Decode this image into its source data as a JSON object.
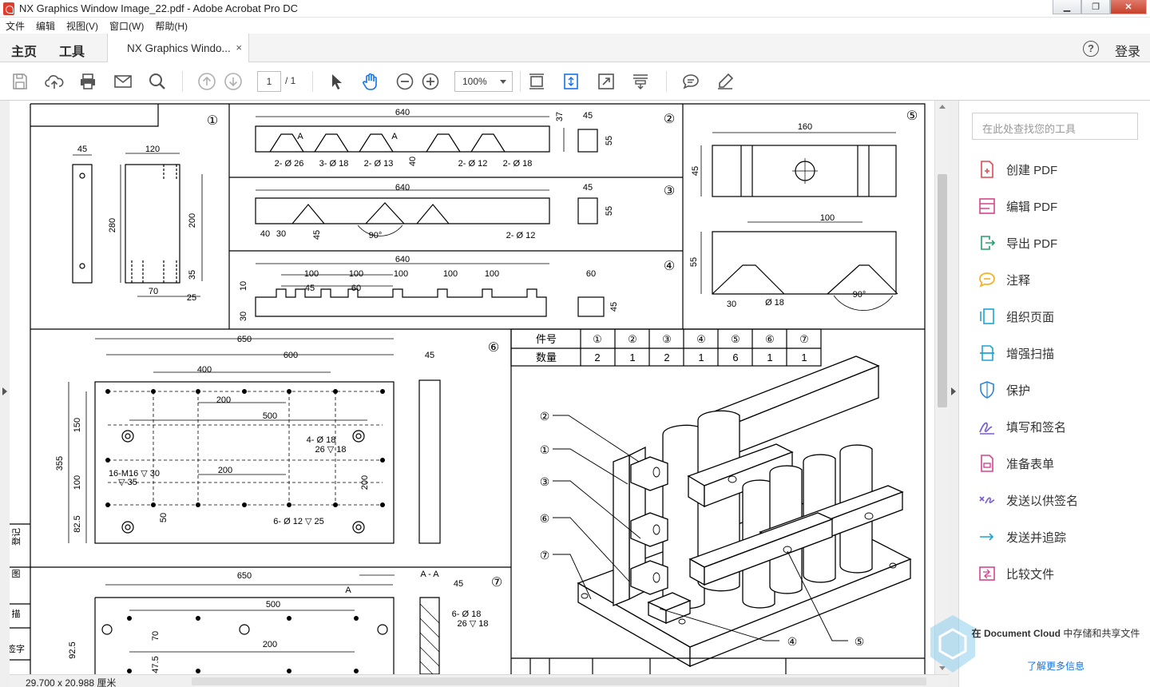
{
  "window": {
    "title": "NX Graphics Window Image_22.pdf - Adobe Acrobat Pro DC",
    "buttons": [
      "minimize",
      "maximize",
      "close"
    ]
  },
  "menu": [
    "文件",
    "编辑",
    "视图(V)",
    "窗口(W)",
    "帮助(H)"
  ],
  "tabs": {
    "home": "主页",
    "tools": "工具",
    "document": "NX Graphics Windo...",
    "close": "×",
    "help": "?",
    "login": "登录"
  },
  "toolbar": {
    "page_current": "1",
    "page_total": "/ 1",
    "zoom": "100%"
  },
  "status": {
    "dimensions": "29.700 x 20.988 厘米"
  },
  "tools_pane": {
    "search_placeholder": "在此处查找您的工具",
    "items": [
      {
        "label": "创建 PDF",
        "icon": "create-pdf-icon",
        "color": "#e34850"
      },
      {
        "label": "编辑 PDF",
        "icon": "edit-pdf-icon",
        "color": "#d7448c"
      },
      {
        "label": "导出 PDF",
        "icon": "export-pdf-icon",
        "color": "#26a06b"
      },
      {
        "label": "注释",
        "icon": "comment-icon",
        "color": "#f2b328"
      },
      {
        "label": "组织页面",
        "icon": "organize-pages-icon",
        "color": "#1fa3d4"
      },
      {
        "label": "增强扫描",
        "icon": "enhance-scan-icon",
        "color": "#1fa3d4"
      },
      {
        "label": "保护",
        "icon": "protect-icon",
        "color": "#2f86d6"
      },
      {
        "label": "填写和签名",
        "icon": "fill-sign-icon",
        "color": "#7a5cd6"
      },
      {
        "label": "准备表单",
        "icon": "prepare-form-icon",
        "color": "#d7448c"
      },
      {
        "label": "发送以供签名",
        "icon": "send-for-signature-icon",
        "color": "#7a5cd6"
      },
      {
        "label": "发送并追踪",
        "icon": "send-track-icon",
        "color": "#1fa3d4"
      },
      {
        "label": "比较文件",
        "icon": "compare-files-icon",
        "color": "#d7448c"
      }
    ],
    "cloud_text_bold": "在 Document Cloud",
    "cloud_text": "中存储和共享文件",
    "learn_more": "了解更多信息"
  },
  "drawing": {
    "part1": {
      "num": "①",
      "dims": [
        "45",
        "120",
        "280",
        "200",
        "35",
        "70",
        "25"
      ]
    },
    "part2": {
      "num": "②",
      "dims": [
        "640",
        "37",
        "45",
        "55",
        "40"
      ],
      "notes": [
        "2- Ø 26",
        "3- Ø 18",
        "2- Ø 13",
        "2- Ø 12",
        "2- Ø 18"
      ],
      "sections": [
        "A",
        "A"
      ]
    },
    "part3": {
      "num": "③",
      "dims": [
        "640",
        "45",
        "55",
        "40",
        "30",
        "45"
      ],
      "notes": [
        "90°",
        "2- Ø 12"
      ]
    },
    "part4": {
      "num": "④",
      "dims": [
        "640",
        "100",
        "100",
        "100",
        "100",
        "100",
        "45",
        "60",
        "10",
        "30",
        "60",
        "45"
      ]
    },
    "part5": {
      "num": "⑤",
      "dims": [
        "160",
        "45",
        "100",
        "55",
        "30"
      ],
      "notes": [
        "Ø 18",
        "90°"
      ]
    },
    "part6": {
      "num": "⑥",
      "dims": [
        "650",
        "600",
        "400",
        "200",
        "500",
        "200",
        "150",
        "355",
        "100",
        "82.5",
        "50",
        "200",
        "45"
      ],
      "notes": [
        "4- Ø 18",
        "26 ▽ 18",
        "16-M16 ▽ 30",
        "▽ 35",
        "6- Ø 12 ▽ 25"
      ]
    },
    "part7": {
      "num": "⑦",
      "dims": [
        "650",
        "500",
        "70",
        "92.5",
        "200",
        "47.5",
        "45"
      ],
      "notes": [
        "A - A",
        "A",
        "6- Ø 18",
        "26 ▽ 18"
      ]
    },
    "table": {
      "headers": [
        "件号",
        "①",
        "②",
        "③",
        "④",
        "⑤",
        "⑥",
        "⑦"
      ],
      "row_label": "数量",
      "values": [
        "2",
        "1",
        "2",
        "1",
        "6",
        "1",
        "1"
      ]
    },
    "balloons": [
      "②",
      "①",
      "③",
      "⑥",
      "⑦",
      "④",
      "⑤"
    ],
    "margin_labels": [
      "登记",
      "图",
      "描",
      "签字"
    ]
  }
}
